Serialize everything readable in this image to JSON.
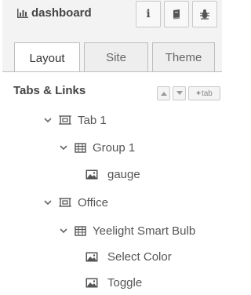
{
  "header": {
    "title": "dashboard",
    "buttons": [
      {
        "name": "info",
        "icon": "info-icon"
      },
      {
        "name": "book",
        "icon": "book-icon"
      },
      {
        "name": "bug",
        "icon": "bug-icon"
      }
    ]
  },
  "tabs": [
    {
      "label": "Layout",
      "active": true
    },
    {
      "label": "Site",
      "active": false
    },
    {
      "label": "Theme",
      "active": false
    }
  ],
  "section": {
    "title": "Tabs & Links",
    "add_tab_label": "tab"
  },
  "tree": [
    {
      "label": "Tab 1",
      "type": "tab",
      "expanded": true
    },
    {
      "label": "Group 1",
      "type": "group",
      "expanded": true
    },
    {
      "label": "gauge",
      "type": "widget"
    },
    {
      "label": "Office",
      "type": "tab",
      "expanded": true
    },
    {
      "label": "Yeelight Smart Bulb",
      "type": "group",
      "expanded": true
    },
    {
      "label": "Select Color",
      "type": "widget"
    },
    {
      "label": "Toggle",
      "type": "widget"
    }
  ],
  "colors": {
    "panel_bg": "#f3f3f3",
    "active_tab_bg": "#ffffff",
    "text": "#555555"
  }
}
